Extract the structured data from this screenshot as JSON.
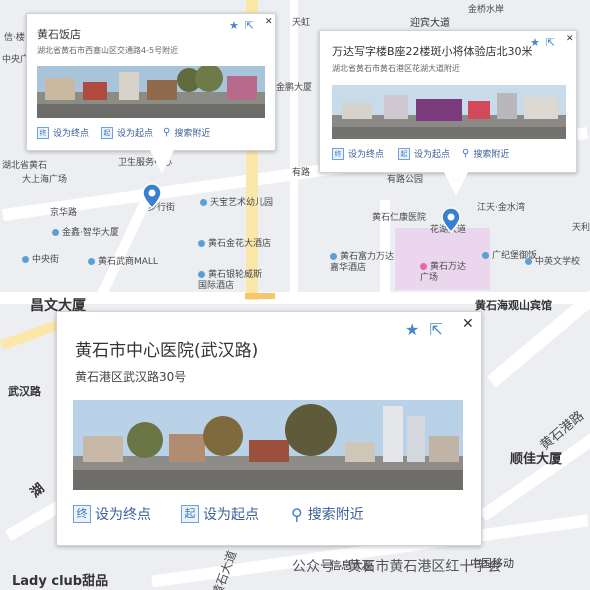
{
  "map": {
    "labels": [
      "金桥水岸",
      "迎宾大道",
      "中央广场",
      "湖北省黄石",
      "卫生服务中心",
      "大上海广场",
      "京华路",
      "步行街",
      "天宝艺术幼儿园",
      "金鑫·智华大厦",
      "黄石金花大酒店",
      "中央街",
      "黄石武商MALL",
      "黄石银轮威斯国际酒店",
      "黄石富力万达嘉华酒店",
      "黄石万达广场",
      "广纪堡御饭",
      "中英文学校",
      "昌文大厦",
      "黄石海观山宾馆",
      "武汉路",
      "顺佳大厦",
      "湖",
      "Lady club甜品",
      "黄石仁康医院",
      "江天·金水湾",
      "花湖大道",
      "有路公园",
      "天利",
      "有路",
      "信息大厦",
      "中国移动",
      "黄石大道",
      "黄石港路",
      "天虹",
      "金鹏大厦",
      "信·楼"
    ]
  },
  "popups": [
    {
      "title": "黄石饭店",
      "address": "湖北省黄石市西塞山区交通路4-5号附近",
      "actions": [
        "设为终点",
        "设为起点",
        "搜索附近"
      ],
      "action_icons": [
        "终",
        "起",
        "search-icon"
      ]
    },
    {
      "title": "万达写字楼B座22楼斑小将体验店北30米",
      "address": "湖北省黄石市黄石港区花湖大道附近",
      "actions": [
        "设为终点",
        "设为起点",
        "搜索附近"
      ],
      "action_icons": [
        "终",
        "起",
        "search-icon"
      ]
    },
    {
      "title": "黄石市中心医院(武汉路)",
      "address": "黄石港区武汉路30号",
      "actions": [
        "设为终点",
        "设为起点",
        "搜索附近"
      ],
      "action_icons": [
        "终",
        "起",
        "search-icon"
      ]
    }
  ],
  "close_glyph": "✕",
  "watermark": "公众号 · 黄石市黄石港区红十字会",
  "colors": {
    "accent": "#4a86c8",
    "road_yellow": "#fbe7a8",
    "mall_pink": "#ead7ee"
  }
}
